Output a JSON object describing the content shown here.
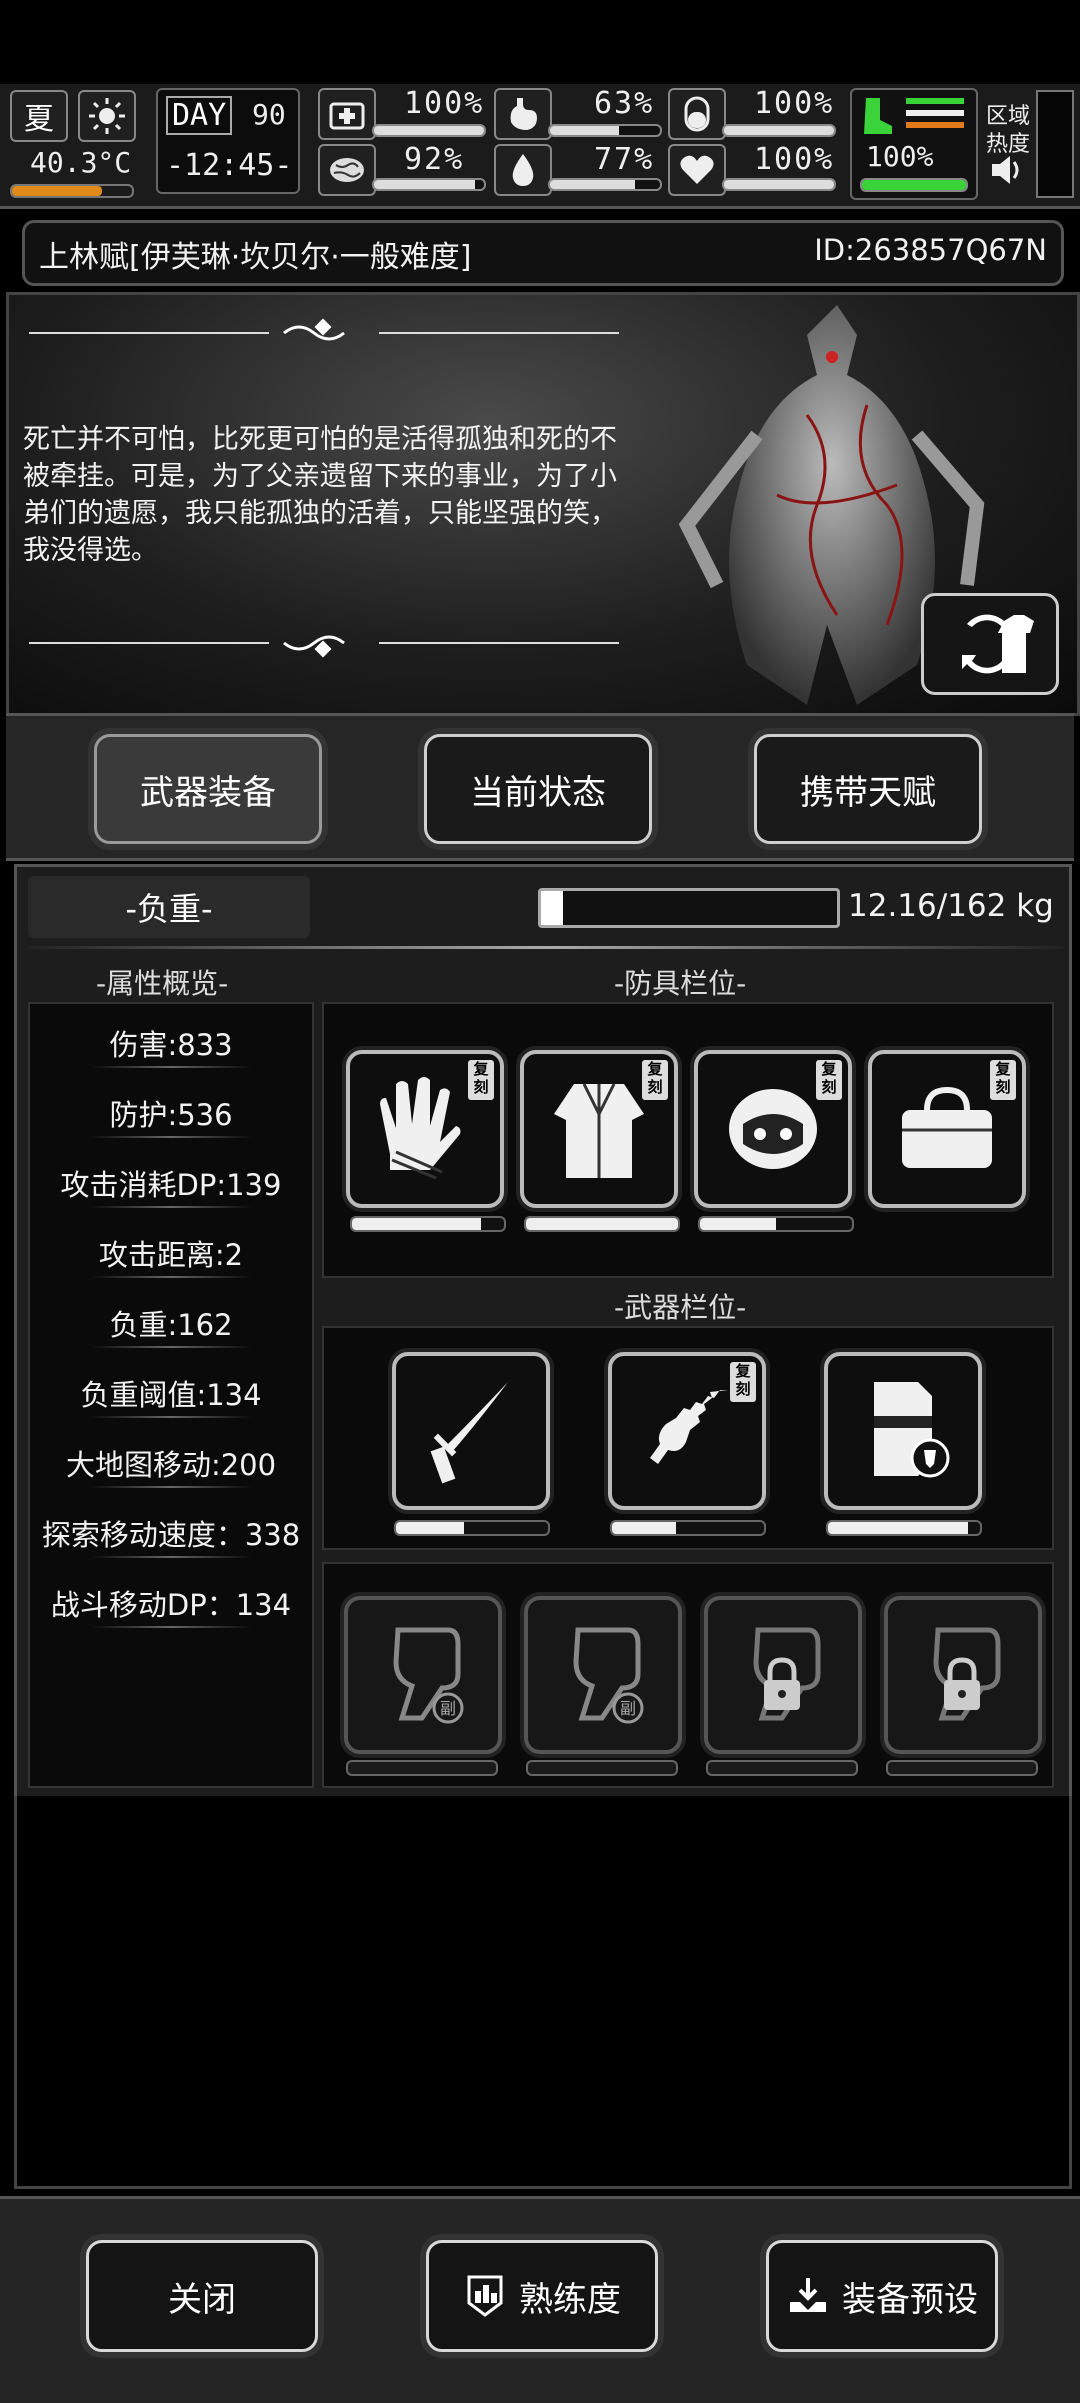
{
  "status_bar": {
    "season": "夏",
    "weather_icon": "sun-icon",
    "temperature": "40.3°C",
    "day_label": "DAY",
    "day_value": "90",
    "clock": "-12:45-",
    "stats": [
      {
        "icon": "medkit-icon",
        "value": "100%",
        "level": 1.0
      },
      {
        "icon": "stomach-icon",
        "value": "63%",
        "level": 0.63
      },
      {
        "icon": "pill-icon",
        "value": "100%",
        "level": 1.0
      },
      {
        "icon": "brain-icon",
        "value": "92%",
        "level": 0.92
      },
      {
        "icon": "water-drop-icon",
        "value": "77%",
        "level": 0.77
      },
      {
        "icon": "heart-icon",
        "value": "100%",
        "level": 1.0
      }
    ],
    "stamina_value": "100%",
    "stamina_level": 1.0,
    "region_label_1": "区域",
    "region_label_2": "热度"
  },
  "character": {
    "name": "上林赋[伊芙琳·坎贝尔·一般难度]",
    "id": "ID:263857Q67N",
    "quote": "死亡并不可怕，比死更可怕的是活得孤独和死的不被牵挂。可是，为了父亲遗留下来的事业，为了小弟们的遗愿，我只能孤独的活着，只能坚强的笑，我没得选。"
  },
  "tabs": [
    {
      "label": "武器装备",
      "active": true
    },
    {
      "label": "当前状态",
      "active": false
    },
    {
      "label": "携带天赋",
      "active": false
    }
  ],
  "load": {
    "label": "-负重-",
    "text": "12.16/162 kg",
    "fraction": 0.075
  },
  "attributes": {
    "title": "-属性概览-",
    "items": [
      "伤害:833",
      "防护:536",
      "攻击消耗DP:139",
      "攻击距离:2",
      "负重:162",
      "负重阈值:134",
      "大地图移动:200",
      "探索移动速度：338",
      "战斗移动DP：134"
    ]
  },
  "armor": {
    "title": "-防具栏位-",
    "badge": "复刻",
    "slots": [
      {
        "icon": "gloves-icon",
        "durability": 0.85
      },
      {
        "icon": "coat-icon",
        "durability": 1.0
      },
      {
        "icon": "helmet-icon",
        "durability": 0.5
      },
      {
        "icon": "bag-icon",
        "durability": 0.0
      }
    ]
  },
  "weapons": {
    "title": "-武器栏位-",
    "badge": "复刻",
    "slots": [
      {
        "icon": "katana-icon",
        "durability": 0.45
      },
      {
        "icon": "serrated-blade-icon",
        "durability": 0.42
      },
      {
        "icon": "riot-shield-icon",
        "durability": 0.92
      }
    ]
  },
  "extra_slots": {
    "sub_label": "副",
    "slots": [
      {
        "icon": "fist-icon",
        "locked": false
      },
      {
        "icon": "fist-icon",
        "locked": false
      },
      {
        "icon": "lock-icon",
        "locked": true
      },
      {
        "icon": "lock-icon",
        "locked": true
      }
    ]
  },
  "bottom": {
    "close": "关闭",
    "proficiency": "熟练度",
    "preset": "装备预设"
  }
}
